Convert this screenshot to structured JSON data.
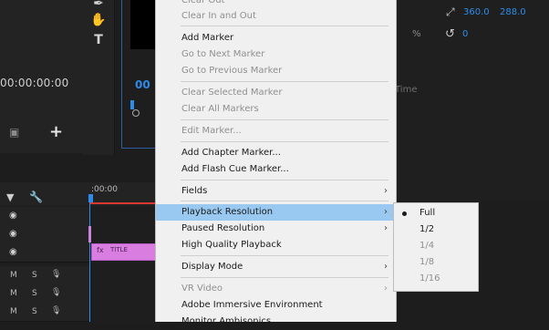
{
  "left_panel": {
    "timecode": "00:00:00:00"
  },
  "tools": {
    "items": [
      "pen-tool",
      "hand-tool",
      "type-tool"
    ],
    "type_glyph": "T"
  },
  "program_monitor": {
    "timecode": "00"
  },
  "effect_controls": {
    "position_x": "360.0",
    "position_y": "288.0",
    "percent_symbol": "%",
    "rotation": "0",
    "time_label": "Time"
  },
  "timeline": {
    "ruler_start": ":00:00",
    "clip_title": "TITLE",
    "tracks": [
      {
        "eye": "◉"
      },
      {
        "eye": "◉"
      },
      {
        "eye": "◉"
      }
    ],
    "audio": [
      {
        "m": "M",
        "s": "S"
      },
      {
        "m": "M",
        "s": "S"
      },
      {
        "m": "M",
        "s": "S"
      }
    ]
  },
  "menu": {
    "items": [
      {
        "label": "Clear Out",
        "state": "disabled"
      },
      {
        "label": "Clear In and Out",
        "state": "disabled"
      },
      {
        "label": "Add Marker",
        "state": "enabled"
      },
      {
        "label": "Go to Next Marker",
        "state": "disabled"
      },
      {
        "label": "Go to Previous Marker",
        "state": "disabled"
      },
      {
        "label": "Clear Selected Marker",
        "state": "disabled"
      },
      {
        "label": "Clear All Markers",
        "state": "disabled"
      },
      {
        "label": "Edit Marker...",
        "state": "disabled"
      },
      {
        "label": "Add Chapter Marker...",
        "state": "enabled"
      },
      {
        "label": "Add Flash Cue Marker...",
        "state": "enabled"
      },
      {
        "label": "Fields",
        "state": "enabled"
      },
      {
        "label": "Playback Resolution",
        "state": "active"
      },
      {
        "label": "Paused Resolution",
        "state": "enabled"
      },
      {
        "label": "High Quality Playback",
        "state": "enabled"
      },
      {
        "label": "Display Mode",
        "state": "enabled"
      },
      {
        "label": "VR Video",
        "state": "disabled"
      },
      {
        "label": "Adobe Immersive Environment",
        "state": "enabled"
      },
      {
        "label": "Monitor Ambisonics",
        "state": "enabled"
      }
    ],
    "submenu_arrow": "›"
  },
  "submenu": {
    "items": [
      {
        "label": "Full",
        "state": "enabled",
        "checked": true
      },
      {
        "label": "1/2",
        "state": "enabled"
      },
      {
        "label": "1/4",
        "state": "disabled"
      },
      {
        "label": "1/8",
        "state": "disabled"
      },
      {
        "label": "1/16",
        "state": "disabled"
      }
    ]
  }
}
